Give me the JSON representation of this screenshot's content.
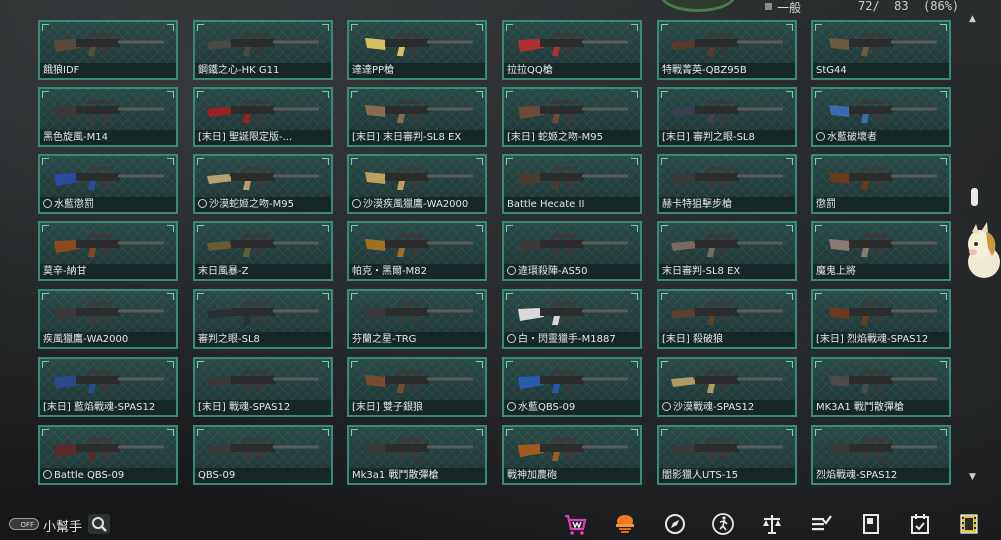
{
  "header": {
    "category_label": "一般",
    "count_text": "72/  83  (86%)"
  },
  "weapons": [
    {
      "name": "餓狼IDF",
      "limited": false,
      "color": "#5a4a3a"
    },
    {
      "name": "鋼鐵之心-HK G11",
      "limited": false,
      "color": "#4a4a42"
    },
    {
      "name": "達達PP槍",
      "limited": false,
      "color": "#d8c060"
    },
    {
      "name": "拉拉QQ槍",
      "limited": false,
      "color": "#b03030"
    },
    {
      "name": "特戰菁英-QBZ95B",
      "limited": false,
      "color": "#5a3a2a"
    },
    {
      "name": "StG44",
      "limited": false,
      "color": "#6a5a40"
    },
    {
      "name": "黑色旋風-M14",
      "limited": false,
      "color": "#3a3a3a"
    },
    {
      "name": "[末日] 聖誕限定版-...",
      "limited": false,
      "color": "#a02020"
    },
    {
      "name": "[末日] 末日審判-SL8 EX",
      "limited": false,
      "color": "#8a6a50"
    },
    {
      "name": "[末日] 蛇姬之吻-M95",
      "limited": false,
      "color": "#6a4a3a"
    },
    {
      "name": "[末日] 審判之眼-SL8",
      "limited": false,
      "color": "#3a4050"
    },
    {
      "name": "水藍破壞者",
      "limited": true,
      "color": "#3a6ab0"
    },
    {
      "name": "水藍懲罰",
      "limited": true,
      "color": "#2a4aa0"
    },
    {
      "name": "沙漠蛇姬之吻-M95",
      "limited": true,
      "color": "#b8a070"
    },
    {
      "name": "沙漠疾風獵鷹-WA2000",
      "limited": true,
      "color": "#c0a060"
    },
    {
      "name": "Battle Hecate II",
      "limited": false,
      "color": "#4a3a30"
    },
    {
      "name": "赫卡特狙擊步槍",
      "limited": false,
      "color": "#3a3a3a"
    },
    {
      "name": "懲罰",
      "limited": false,
      "color": "#6a3a20"
    },
    {
      "name": "莫辛-納甘",
      "limited": false,
      "color": "#8a4a20"
    },
    {
      "name": "末日風暴-Z",
      "limited": false,
      "color": "#6a5a30"
    },
    {
      "name": "帕克・黑爾-M82",
      "limited": false,
      "color": "#a07020"
    },
    {
      "name": "違環殺陣-AS50",
      "limited": true,
      "color": "#3a3a3a"
    },
    {
      "name": "末日審判-SL8 EX",
      "limited": false,
      "color": "#7a6a60"
    },
    {
      "name": "魔鬼上將",
      "limited": false,
      "color": "#8a7a70"
    },
    {
      "name": "疾風獵鷹-WA2000",
      "limited": false,
      "color": "#3a3a3a"
    },
    {
      "name": "審判之眼-SL8",
      "limited": false,
      "color": "#2a2e36"
    },
    {
      "name": "芬蘭之星-TRG",
      "limited": false,
      "color": "#3a3a3a"
    },
    {
      "name": "白・閃靈獵手-M1887",
      "limited": true,
      "color": "#d8d8d8"
    },
    {
      "name": "[末日] 殺破狼",
      "limited": false,
      "color": "#5a4030"
    },
    {
      "name": "[末日] 烈焰戰魂-SPAS12",
      "limited": false,
      "color": "#6a3a20"
    },
    {
      "name": "[末日] 藍焰戰魂-SPAS12",
      "limited": false,
      "color": "#2a4a8a"
    },
    {
      "name": "[末日] 戰魂-SPAS12",
      "limited": false,
      "color": "#3a3a3a"
    },
    {
      "name": "[末日] 雙子銀狼",
      "limited": false,
      "color": "#7a4a30"
    },
    {
      "name": "水藍QBS-09",
      "limited": true,
      "color": "#2a5ab0"
    },
    {
      "name": "沙漠戰魂-SPAS12",
      "limited": true,
      "color": "#b09a60"
    },
    {
      "name": "MK3A1 戰鬥散彈槍",
      "limited": false,
      "color": "#4a4a4a"
    },
    {
      "name": "Battle QBS-09",
      "limited": true,
      "color": "#5a2a2a"
    },
    {
      "name": "QBS-09",
      "limited": false,
      "color": "#3a3a3a"
    },
    {
      "name": "Mk3a1 戰鬥散彈槍",
      "limited": false,
      "color": "#3a3a3a"
    },
    {
      "name": "戰神加農砲",
      "limited": false,
      "color": "#a05a20"
    },
    {
      "name": "闇影獵人UTS-15",
      "limited": false,
      "color": "#3a3a3a"
    },
    {
      "name": "烈焰戰魂-SPAS12",
      "limited": false,
      "color": "#3a3a3a"
    }
  ],
  "footer": {
    "toggle_label": "OFF",
    "helper_label": "小幫手",
    "icons": [
      "shop-icon",
      "hat-icon",
      "compass-icon",
      "run-icon",
      "scale-icon",
      "checklist-icon",
      "card-icon",
      "calendar-check-icon",
      "film-icon"
    ]
  }
}
